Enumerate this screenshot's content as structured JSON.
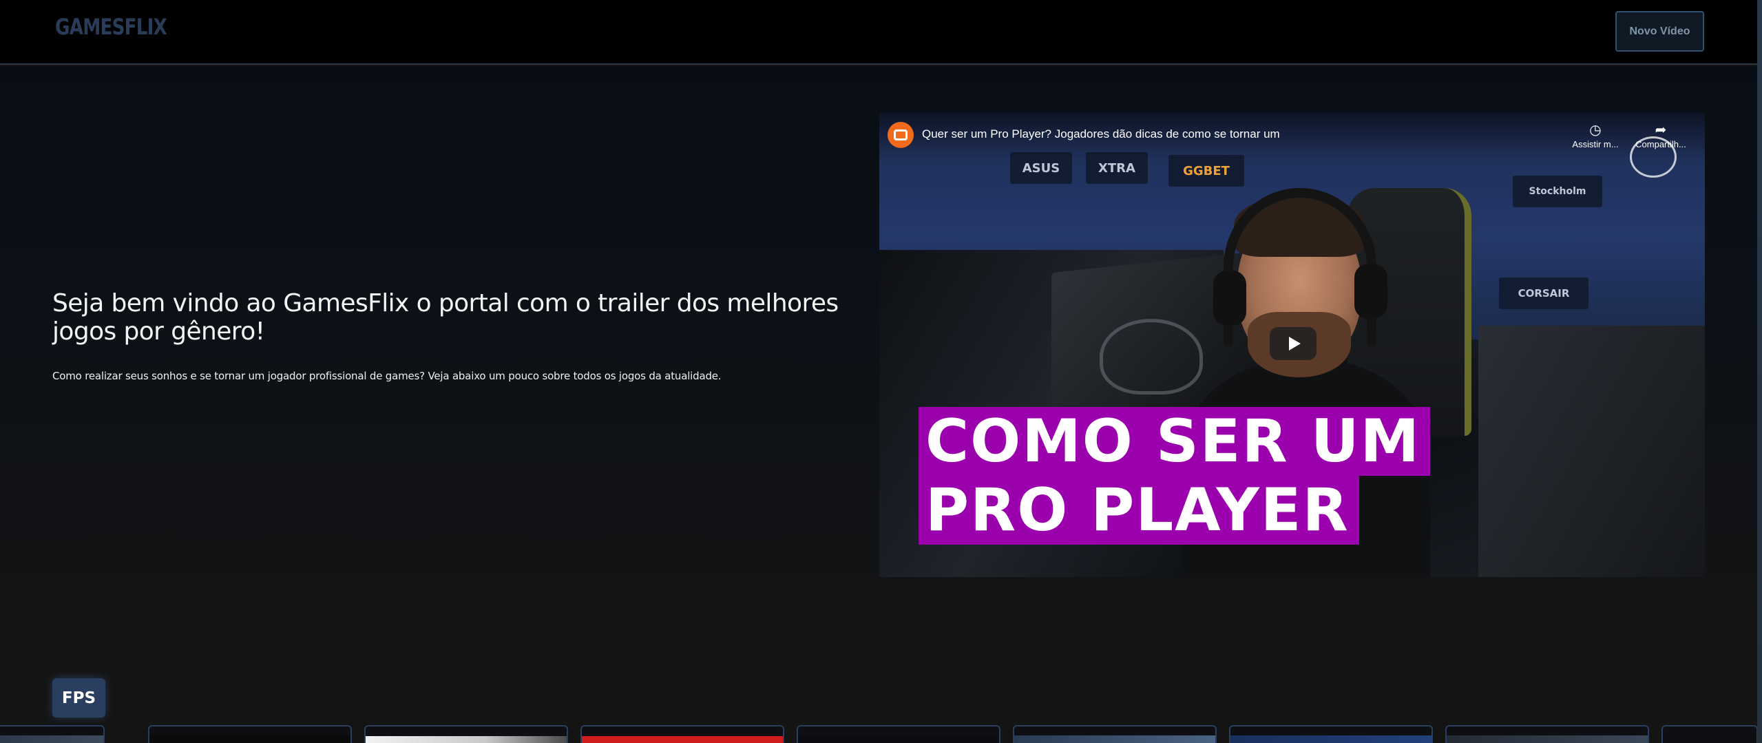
{
  "header": {
    "logo": "GAMESFLIX",
    "new_video_label": "Novo Vídeo"
  },
  "hero": {
    "title": "Seja bem vindo ao GamesFlix o portal com o trailer dos melhores jogos por gênero!",
    "description": "Como realizar seus sonhos e se tornar um jogador profissional de games? Veja abaixo um pouco sobre todos os jogos da atualidade."
  },
  "video": {
    "title": "Quer ser um Pro Player? Jogadores dão dicas de como se tornar um",
    "watch_later_label": "Assistir m...",
    "share_label": "Compartilh...",
    "overlay_line_1": "COMO SER UM",
    "overlay_line_2": "PRO PLAYER",
    "wall_logos": [
      "ASUS",
      "XTRA",
      "GGBET",
      "CORSAIR",
      "Stockholm",
      "CORSAIR"
    ]
  },
  "category": {
    "label": "FPS",
    "color": "#2a3f5f",
    "card_count": 9
  },
  "colors": {
    "background": "#141414",
    "header": "#000000",
    "accent": "#2a3f5f",
    "overlay_purple": "#9b00ad"
  }
}
